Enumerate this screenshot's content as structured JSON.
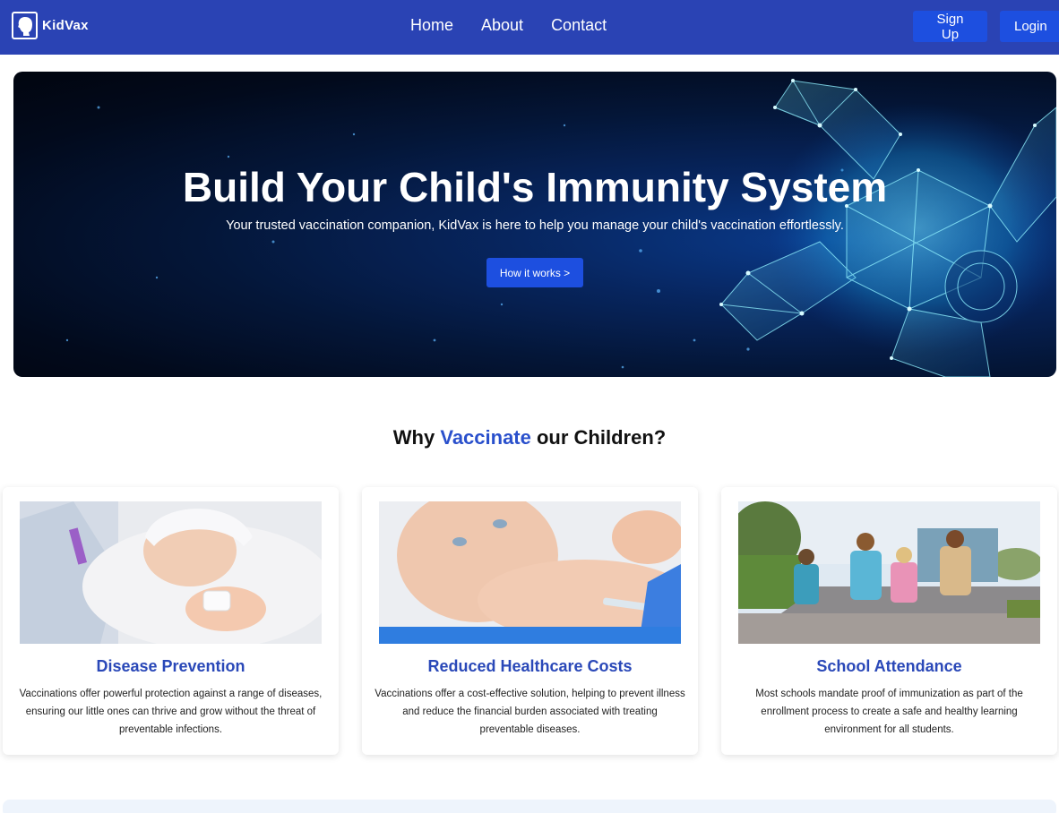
{
  "brand": {
    "name": "KidVax",
    "icon": "child-head-icon"
  },
  "nav": {
    "links": [
      "Home",
      "About",
      "Contact"
    ],
    "signup_label": "Sign Up",
    "login_label": "Login"
  },
  "hero": {
    "title": "Build Your Child's Immunity System",
    "subtitle": "Your trusted vaccination companion, KidVax is here to help you manage your child's vaccination effortlessly.",
    "cta_label": "How it works >"
  },
  "why": {
    "heading_prefix": "Why ",
    "heading_accent": "Vaccinate",
    "heading_suffix": " our Children?",
    "cards": [
      {
        "title": "Disease Prevention",
        "text": "Vaccinations offer powerful protection against a range of diseases, ensuring our little ones can thrive and grow without the threat of preventable infections."
      },
      {
        "title": "Reduced Healthcare Costs",
        "text": "Vaccinations offer a cost-effective solution, helping to prevent illness and reduce the financial burden associated with treating preventable diseases."
      },
      {
        "title": "School Attendance",
        "text": "Most schools mandate proof of immunization as part of the enrollment process to create a safe and healthy learning environment for all students."
      }
    ]
  },
  "colors": {
    "navbar": "#2a43b4",
    "button": "#1d4fe0",
    "accent": "#2a50cc",
    "card_title": "#2a48b8"
  }
}
